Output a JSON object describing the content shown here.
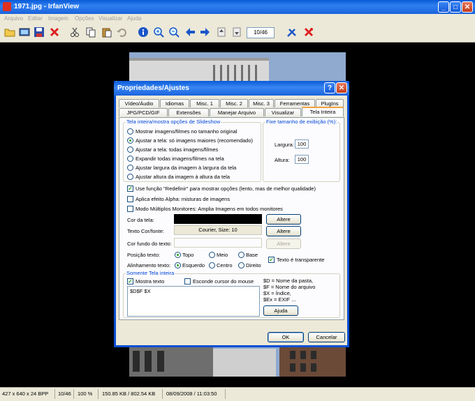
{
  "window": {
    "title": "1971.jpg - IrfanView"
  },
  "menu": [
    "Arquivo",
    "Editar",
    "Imagem",
    "Opções",
    "Visualizar",
    "Ajuda"
  ],
  "toolbar": {
    "page_field": "10/46"
  },
  "status": [
    "427 x 640 x 24 BPP",
    "10/46",
    "100 %",
    "150.85 KB / 802.54 KB",
    "08/09/2008 / 11:03:50"
  ],
  "dialog": {
    "title": "Propriedades/Ajustes",
    "tabs_row1": [
      "Vídeo/Áudio",
      "Idiomas",
      "Misc. 1",
      "Misc. 2",
      "Misc. 3",
      "Ferramentas",
      "PlugIns"
    ],
    "tabs_row2": [
      "JPG/PCD/GIF",
      "Extensões",
      "Manejar Arquivo",
      "Visualizar",
      "Tela Inteira"
    ],
    "slideshow_group": "Tela inteira/mostra opções de Slideshow",
    "radio_options": [
      "Mostrar imagens/filmes no tamanho original",
      "Ajustar a tela: só imagens maiores (recomendado)",
      "Ajustar a tela: todas imagens/filmes",
      "Expandir todas imagens/filmes na tela",
      "Ajustar largura da imagem à largura da tela",
      "Ajustar altura da imagem à altura da tela"
    ],
    "size_group": "Fixe tamanho de exibição (%):",
    "largura_label": "Largura:",
    "largura_value": "100",
    "altura_label": "Altura:",
    "altura_value": "100",
    "check_redefine": "Use função \"Redefinir\" para mostrar opções (lento, mas de melhor qualidade)",
    "check_alpha": "Aplica efeito Alpha: misturas de imagens",
    "check_monitors": "Modo Múltiplos Monitores: Amplia Imagens em todos monitores",
    "cor_tela": "Cor da tela:",
    "texto_cor": "Texto Cor/fonte:",
    "font_value": "Courier, Size: 10",
    "cor_fundo": "Cor fundo do texto:",
    "altere": "Altere",
    "posicao": "Posição texto:",
    "pos_options": [
      "Topo",
      "Meio",
      "Base"
    ],
    "alinhamento": "Alinhamento texto:",
    "align_options": [
      "Esquerdo",
      "Centro",
      "Direito"
    ],
    "transparente": "Texto é transparente",
    "somente_group": "Somente Tela inteira",
    "mostra_texto": "Mostra texto",
    "esconde_cursor": "Esconde cursor do mouse",
    "text_value": "$D$F $X",
    "help_lines": [
      "$D = Nome da pasta,",
      "$F = Nome do arquivo",
      "$X = Índice,",
      "$Ex = EXIF ..."
    ],
    "ajuda": "Ajuda",
    "ok": "OK",
    "cancel": "Cancelar"
  }
}
